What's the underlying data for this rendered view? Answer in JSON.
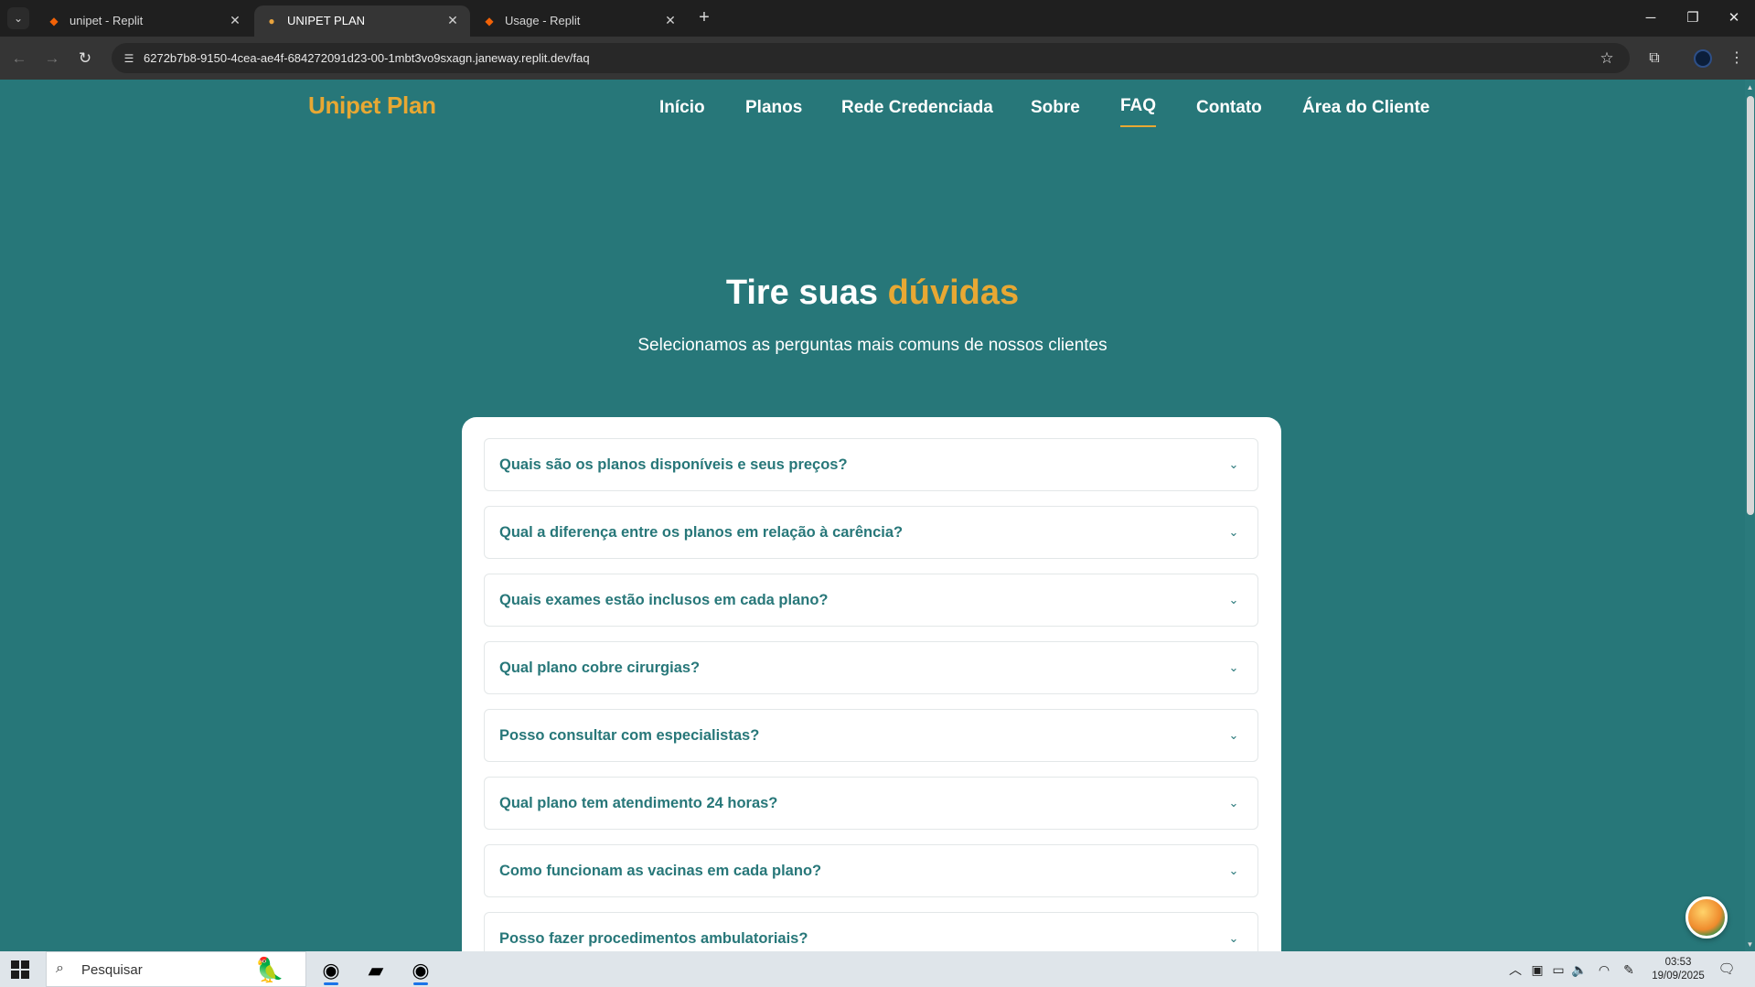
{
  "browser": {
    "tabs": [
      {
        "title": "unipet - Replit",
        "favicon": "replit-icon",
        "active": false
      },
      {
        "title": "UNIPET PLAN",
        "favicon": "paw-icon",
        "active": true
      },
      {
        "title": "Usage - Replit",
        "favicon": "replit-icon",
        "active": false
      }
    ],
    "url": "6272b7b8-9150-4cea-ae4f-684272091d23-00-1mbt3vo9sxagn.janeway.replit.dev/faq"
  },
  "site": {
    "logo": "Unipet Plan",
    "nav": [
      {
        "label": "Início",
        "active": false
      },
      {
        "label": "Planos",
        "active": false
      },
      {
        "label": "Rede Credenciada",
        "active": false
      },
      {
        "label": "Sobre",
        "active": false
      },
      {
        "label": "FAQ",
        "active": true
      },
      {
        "label": "Contato",
        "active": false
      },
      {
        "label": "Área do Cliente",
        "active": false
      }
    ],
    "hero": {
      "title_plain": "Tire suas",
      "title_accent": "dúvidas",
      "subtitle": "Selecionamos as perguntas mais comuns de nossos clientes"
    },
    "faq": [
      {
        "question": "Quais são os planos disponíveis e seus preços?"
      },
      {
        "question": "Qual a diferença entre os planos em relação à carência?"
      },
      {
        "question": "Quais exames estão inclusos em cada plano?"
      },
      {
        "question": "Qual plano cobre cirurgias?"
      },
      {
        "question": "Posso consultar com especialistas?"
      },
      {
        "question": "Qual plano tem atendimento 24 horas?"
      },
      {
        "question": "Como funcionam as vacinas em cada plano?"
      },
      {
        "question": "Posso fazer procedimentos ambulatoriais?"
      }
    ],
    "colors": {
      "primary": "#277779",
      "accent": "#e8a833"
    }
  },
  "taskbar": {
    "search_placeholder": "Pesquisar",
    "time": "03:53",
    "date": "19/09/2025"
  }
}
